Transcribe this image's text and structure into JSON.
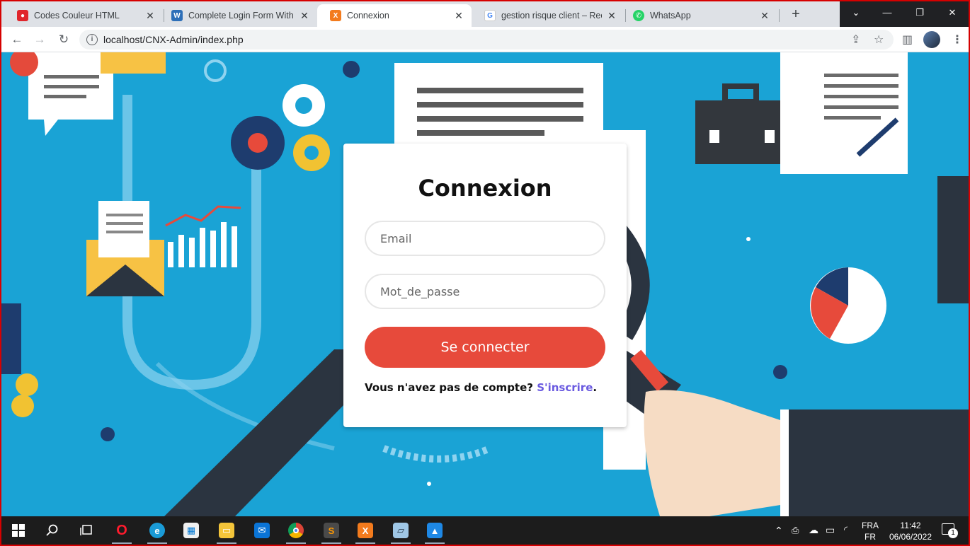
{
  "browser": {
    "tabs": [
      {
        "title": "Codes Couleur HTML",
        "icon": "opera-red-icon",
        "color": "#e0252b",
        "active": false
      },
      {
        "title": "Complete Login Form With S",
        "icon": "wordpress-icon",
        "color": "#2d6fb8",
        "active": false
      },
      {
        "title": "Connexion",
        "icon": "xampp-icon",
        "color": "#f37b1d",
        "active": true
      },
      {
        "title": "gestion risque client – Reche",
        "icon": "google-icon",
        "color": "#4285f4",
        "active": false
      },
      {
        "title": "WhatsApp",
        "icon": "whatsapp-icon",
        "color": "#25d366",
        "active": false
      }
    ],
    "new_tab_label": "+",
    "url": "localhost/CNX-Admin/index.php"
  },
  "form": {
    "title": "Connexion",
    "email_placeholder": "Email",
    "password_placeholder": "Mot_de_passe",
    "submit_label": "Se connecter",
    "signup_prompt": "Vous n'avez pas de compte?",
    "signup_link": "S'inscrire",
    "signup_end": "."
  },
  "taskbar": {
    "apps": [
      "opera-icon",
      "edge-icon",
      "store-icon",
      "file-explorer-icon",
      "mail-icon",
      "chrome-icon",
      "sublime-text-icon",
      "xampp-icon",
      "notepad-icon",
      "photos-icon"
    ],
    "language_top": "FRA",
    "language_bottom": "FR",
    "time": "11:42",
    "date": "06/06/2022",
    "notification_count": "1"
  },
  "colors": {
    "accent_button": "#e74a3b",
    "link": "#6a5ae0",
    "background": "#1aa3d5"
  }
}
